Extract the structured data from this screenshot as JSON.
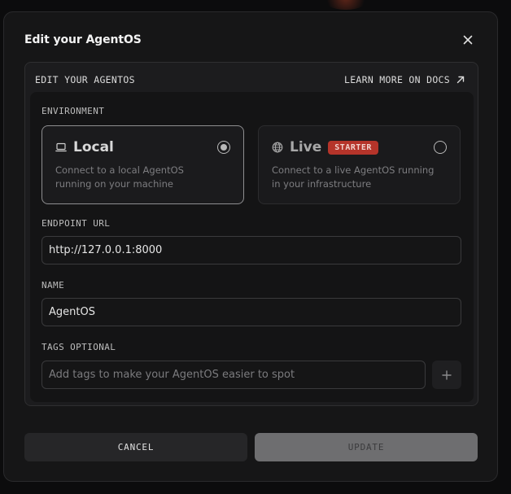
{
  "modal": {
    "title": "Edit your AgentOS",
    "close_icon": "close-icon"
  },
  "panel": {
    "header": "EDIT YOUR AGENTOS",
    "docs_link": "LEARN MORE ON DOCS",
    "docs_icon": "arrow-up-right-icon"
  },
  "environment": {
    "label": "ENVIRONMENT",
    "options": [
      {
        "title": "Local",
        "icon": "laptop-icon",
        "description": "Connect to a local AgentOS running on your machine",
        "selected": true
      },
      {
        "title": "Live",
        "icon": "globe-icon",
        "badge": "STARTER",
        "description": "Connect to a live AgentOS running in your infrastructure",
        "selected": false
      }
    ]
  },
  "endpoint": {
    "label": "ENDPOINT URL",
    "value": "http://127.0.0.1:8000"
  },
  "name": {
    "label": "NAME",
    "value": "AgentOS"
  },
  "tags": {
    "label": "TAGS OPTIONAL",
    "placeholder": "Add tags to make your AgentOS easier to spot",
    "add_icon": "plus-icon"
  },
  "footer": {
    "cancel_label": "CANCEL",
    "update_label": "UPDATE"
  },
  "colors": {
    "background": "#0c0c0d",
    "modal": "#161617",
    "badge": "#b5342a",
    "update_disabled": "#6e6e70"
  }
}
